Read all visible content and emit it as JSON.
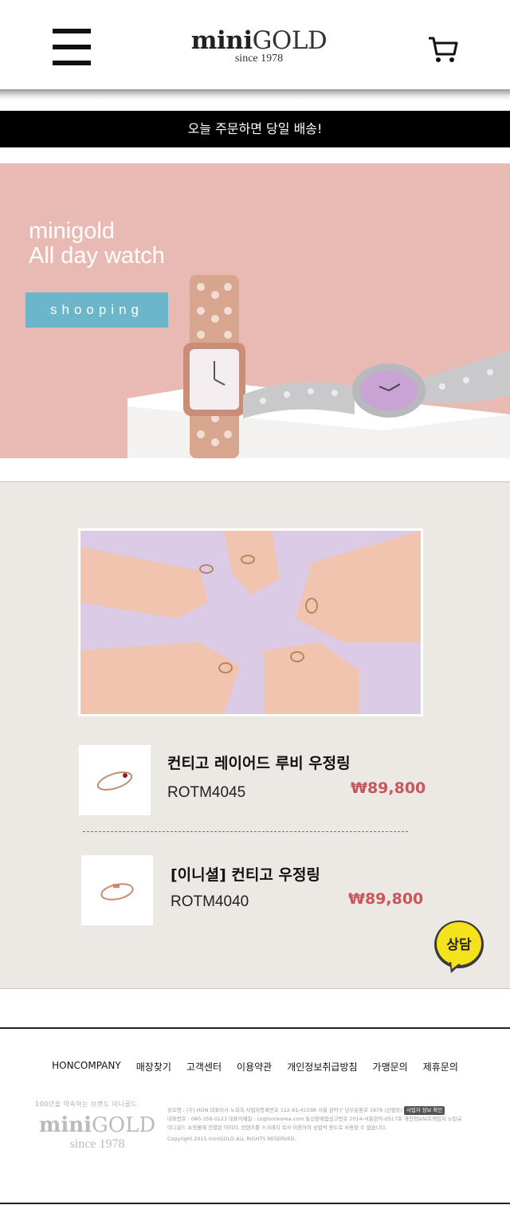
{
  "header": {
    "logo_main_bold": "mini",
    "logo_main_light": "GOLD",
    "logo_sub": "since 1978"
  },
  "notice": {
    "text": "오늘 주문하면 당일 배송!"
  },
  "banner": {
    "title_line1": "minigold",
    "title_line2": "All day watch",
    "button_label": "shooping",
    "button_color": "#6bb6c8",
    "background_color": "#e9bab3"
  },
  "products": [
    {
      "name": "컨티고 레이어드 루비 우정링",
      "code": "ROTM4045",
      "price": "₩89,800"
    },
    {
      "name": "[이니셜] 컨티고 우정링",
      "code": "ROTM4040",
      "price": "₩89,800"
    }
  ],
  "chat": {
    "label": "상담",
    "color": "#f4e21c"
  },
  "footer": {
    "links": [
      "HONCOMPANY",
      "매장찾기",
      "고객센터",
      "이용약관",
      "개인정보취급방침",
      "가맹문의",
      "제휴문의"
    ],
    "logo_tagline": "100년을 약속하는 브랜드 미니골드",
    "logo_main_bold": "mini",
    "logo_main_light": "GOLD",
    "logo_sub": "since 1978",
    "info_line1": "상호명 : (주) HON   대표이사 노희옥   사업자등록번호  112-81-41598   서울 관악구 남부순환로 1676 (신림동)",
    "info_badge": "사업자 정보 확인",
    "info_line2": "대표번호 : 080-356-0123   대표이메일 : cs@honkorea.com   통신판매업신고번호 2014-서울관악-0517호   개인정보보호책임자 노탄규",
    "info_line3": "미니골드 쇼핑몰에 진열된 이미지, 컨텐츠를 스크래치 복사 이용하여 상업적 용도로 사용할 수 없습니다.",
    "info_line4": "Copyright 2015 miniGOLD ALL RIGHTS RESERVED."
  }
}
